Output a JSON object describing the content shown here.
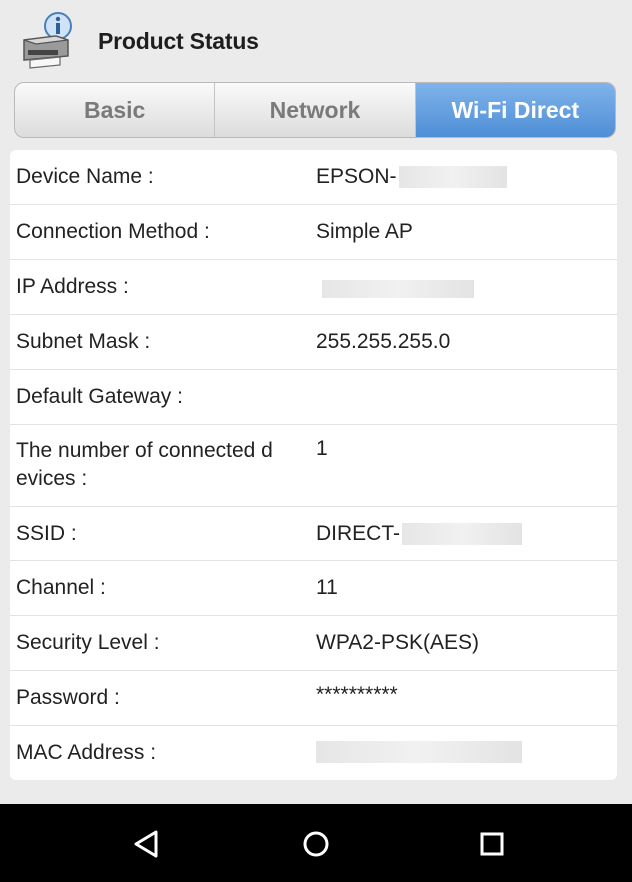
{
  "header": {
    "title": "Product Status",
    "icon": "printer-info-icon"
  },
  "tabs": [
    {
      "label": "Basic",
      "active": false
    },
    {
      "label": "Network",
      "active": false
    },
    {
      "label": "Wi-Fi Direct",
      "active": true
    }
  ],
  "details": [
    {
      "label": "Device Name :",
      "value": "EPSON-",
      "redacted": true
    },
    {
      "label": "Connection Method :",
      "value": "Simple AP"
    },
    {
      "label": "IP Address :",
      "value": "",
      "redacted": true
    },
    {
      "label": "Subnet Mask :",
      "value": "255.255.255.0"
    },
    {
      "label": "Default Gateway :",
      "value": ""
    },
    {
      "label": "The number of connected d",
      "label_line2": "evices :",
      "value": "1"
    },
    {
      "label": "SSID :",
      "value": "DIRECT-",
      "redacted": true
    },
    {
      "label": "Channel :",
      "value": "11"
    },
    {
      "label": "Security Level :",
      "value": "WPA2-PSK(AES)"
    },
    {
      "label": "Password :",
      "value": "**********"
    },
    {
      "label": "MAC Address :",
      "value": "",
      "redacted": true
    }
  ],
  "navbar": {
    "back_icon": "back-triangle-icon",
    "home_icon": "home-circle-icon",
    "recents_icon": "recents-square-icon"
  },
  "colors": {
    "active_tab": "#5b9be0",
    "background": "#ebebeb",
    "navbar": "#000000"
  }
}
